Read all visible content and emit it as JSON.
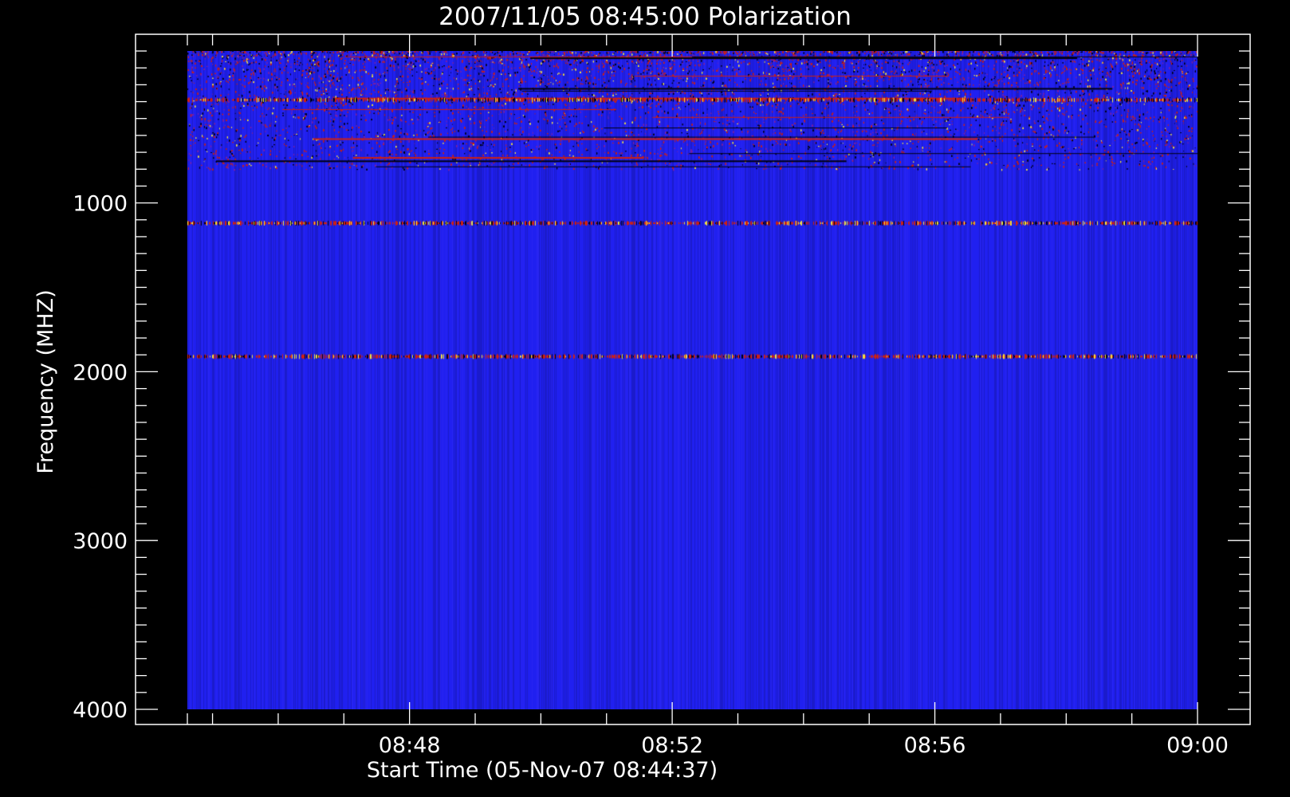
{
  "chart_data": {
    "type": "heatmap",
    "title": "2007/11/05 08:45:00 Polarization",
    "xlabel": "Start Time (05-Nov-07 08:44:37)",
    "ylabel": "Frequency (MHZ)",
    "x_range": [
      "08:44:37",
      "09:00:00"
    ],
    "y_range": [
      100,
      4000
    ],
    "y_inverted": true,
    "x_ticks": [
      "08:48",
      "08:52",
      "08:56",
      "09:00"
    ],
    "y_ticks": [
      1000,
      2000,
      3000,
      4000
    ],
    "grid": false,
    "background_color": "#000000",
    "colors": {
      "base": "#2020f0",
      "red": "#d02010",
      "yellow": "#f0e040",
      "dark": "#000010"
    },
    "features": [
      {
        "name": "dense interference",
        "freq_range_mhz": [
          100,
          800
        ],
        "time_range": [
          "08:44:37",
          "09:00:00"
        ]
      },
      {
        "name": "bright band",
        "freq_mhz": 390,
        "time_range": [
          "08:44:37",
          "09:00:00"
        ]
      },
      {
        "name": "spiky band",
        "freq_mhz": 1120,
        "time_range": [
          "08:44:37",
          "09:00:00"
        ]
      },
      {
        "name": "red/dark band",
        "freq_mhz": 1910,
        "time_range": [
          "08:44:37",
          "09:00:00"
        ]
      }
    ]
  }
}
